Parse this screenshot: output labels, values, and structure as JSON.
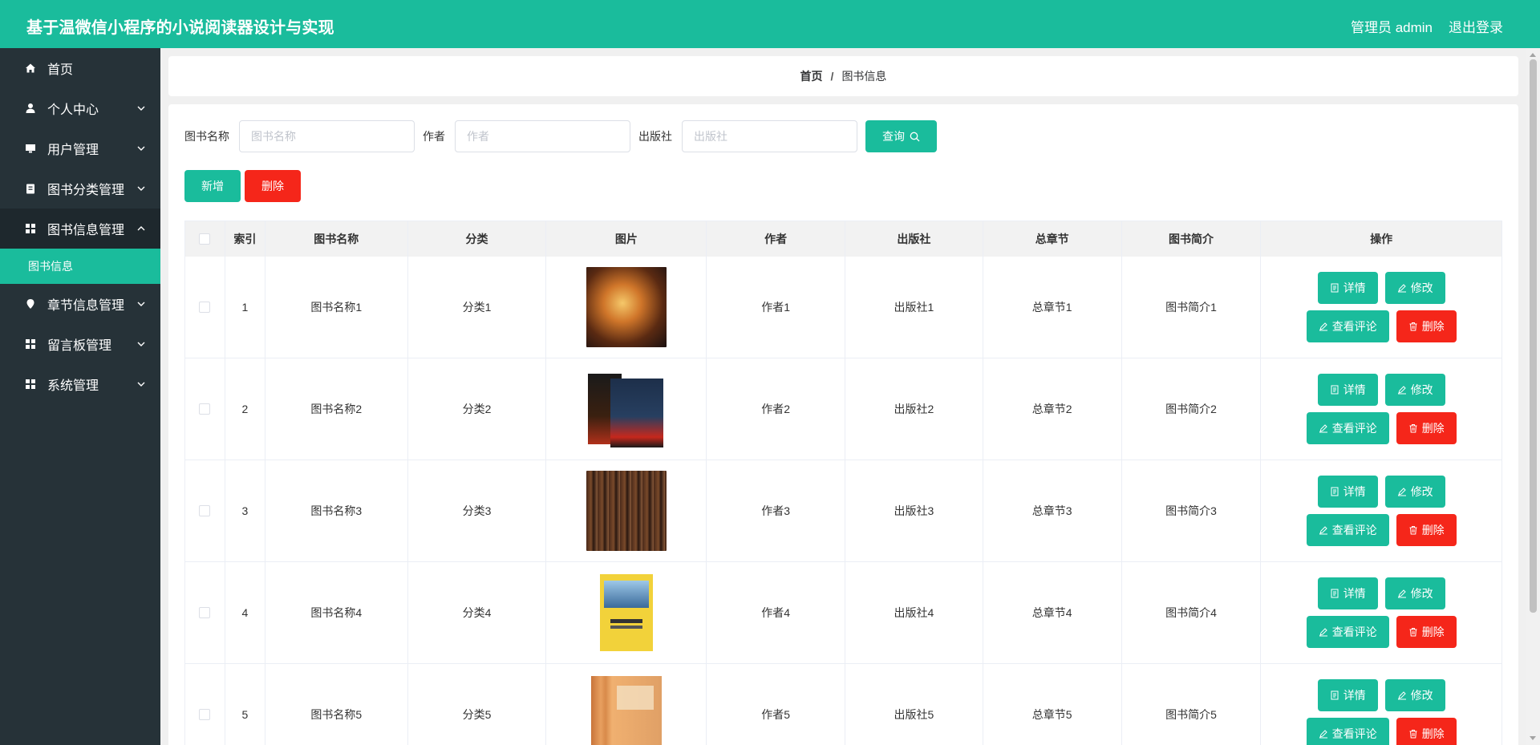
{
  "header": {
    "title": "基于温微信小程序的小说阅读器设计与实现",
    "user": "管理员 admin",
    "logout": "退出登录"
  },
  "sidebar": {
    "items": [
      {
        "label": "首页",
        "icon": "home-icon",
        "has_children": false
      },
      {
        "label": "个人中心",
        "icon": "user-icon",
        "has_children": true
      },
      {
        "label": "用户管理",
        "icon": "monitor-icon",
        "has_children": true
      },
      {
        "label": "图书分类管理",
        "icon": "clipboard-icon",
        "has_children": true
      },
      {
        "label": "图书信息管理",
        "icon": "grid-icon",
        "has_children": true,
        "expanded": true
      },
      {
        "label": "章节信息管理",
        "icon": "location-icon",
        "has_children": true
      },
      {
        "label": "留言板管理",
        "icon": "grid-icon",
        "has_children": true
      },
      {
        "label": "系统管理",
        "icon": "grid-icon",
        "has_children": true
      }
    ],
    "sub_item": "图书信息"
  },
  "breadcrumb": {
    "home": "首页",
    "separator": "/",
    "current": "图书信息"
  },
  "search": {
    "name_label": "图书名称",
    "name_placeholder": "图书名称",
    "author_label": "作者",
    "author_placeholder": "作者",
    "publisher_label": "出版社",
    "publisher_placeholder": "出版社",
    "query_label": "查询"
  },
  "actions": {
    "add": "新增",
    "delete": "删除"
  },
  "table": {
    "headers": [
      "索引",
      "图书名称",
      "分类",
      "图片",
      "作者",
      "出版社",
      "总章节",
      "图书简介",
      "操作"
    ],
    "rows": [
      {
        "index": "1",
        "name": "图书名称1",
        "category": "分类1",
        "author": "作者1",
        "publisher": "出版社1",
        "chapters": "总章节1",
        "intro": "图书简介1"
      },
      {
        "index": "2",
        "name": "图书名称2",
        "category": "分类2",
        "author": "作者2",
        "publisher": "出版社2",
        "chapters": "总章节2",
        "intro": "图书简介2"
      },
      {
        "index": "3",
        "name": "图书名称3",
        "category": "分类3",
        "author": "作者3",
        "publisher": "出版社3",
        "chapters": "总章节3",
        "intro": "图书简介3"
      },
      {
        "index": "4",
        "name": "图书名称4",
        "category": "分类4",
        "author": "作者4",
        "publisher": "出版社4",
        "chapters": "总章节4",
        "intro": "图书简介4"
      },
      {
        "index": "5",
        "name": "图书名称5",
        "category": "分类5",
        "author": "作者5",
        "publisher": "出版社5",
        "chapters": "总章节5",
        "intro": "图书简介5"
      }
    ],
    "ops": {
      "detail": "详情",
      "edit": "修改",
      "comments": "查看评论",
      "delete": "删除"
    }
  },
  "colors": {
    "accent": "#1abc9c",
    "danger": "#f5261a",
    "sidebar": "#263238"
  }
}
